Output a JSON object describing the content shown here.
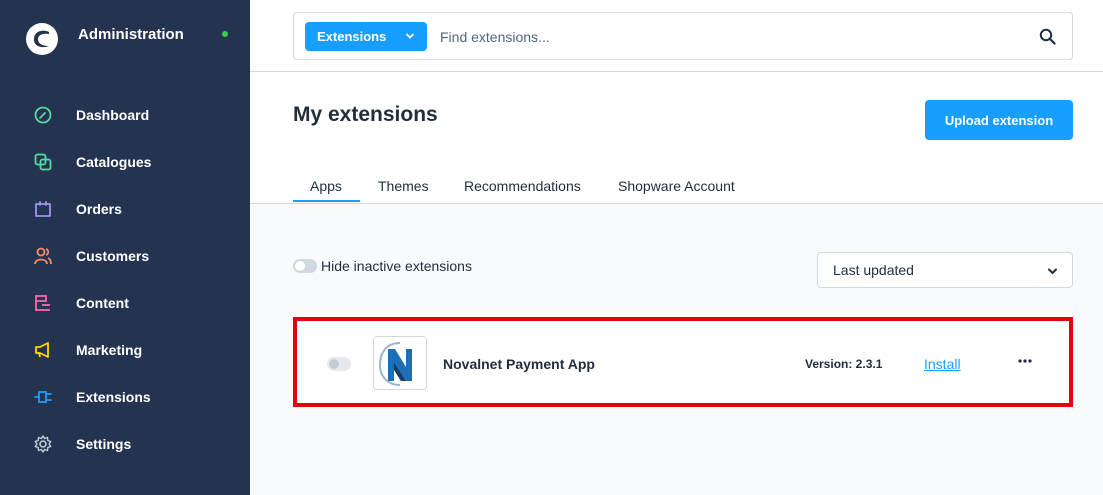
{
  "sidebar": {
    "title": "Administration",
    "status_color": "#37d046",
    "items": [
      {
        "label": "Dashboard",
        "icon": "gauge-icon",
        "color": "#57d9a3"
      },
      {
        "label": "Catalogues",
        "icon": "catalogue-icon",
        "color": "#57d9a3"
      },
      {
        "label": "Orders",
        "icon": "shopping-bag-icon",
        "color": "#a092f0"
      },
      {
        "label": "Customers",
        "icon": "users-icon",
        "color": "#f88962"
      },
      {
        "label": "Content",
        "icon": "content-icon",
        "color": "#ff68b4"
      },
      {
        "label": "Marketing",
        "icon": "megaphone-icon",
        "color": "#ffd700"
      },
      {
        "label": "Extensions",
        "icon": "plug-icon",
        "color": "#189eff"
      },
      {
        "label": "Settings",
        "icon": "gear-icon",
        "color": "#9aa8b5"
      }
    ]
  },
  "search": {
    "type_label": "Extensions",
    "placeholder": "Find extensions..."
  },
  "page": {
    "title": "My extensions",
    "upload_label": "Upload extension",
    "tabs": [
      {
        "label": "Apps",
        "active": true
      },
      {
        "label": "Themes",
        "active": false
      },
      {
        "label": "Recommendations",
        "active": false
      },
      {
        "label": "Shopware Account",
        "active": false
      }
    ]
  },
  "filters": {
    "hide_inactive_label": "Hide inactive extensions",
    "sort_value": "Last updated"
  },
  "extension": {
    "name": "Novalnet Payment App",
    "version": "Version: 2.3.1",
    "install_label": "Install",
    "highlight_color": "#e3000f"
  },
  "colors": {
    "sidebar_bg": "#243450",
    "accent": "#189eff"
  }
}
